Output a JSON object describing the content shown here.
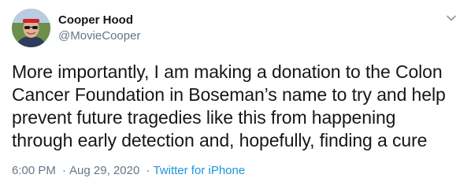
{
  "author": {
    "display_name": "Cooper Hood",
    "handle": "@MovieCooper"
  },
  "tweet": {
    "text": "More importantly, I am making a donation to the Colon Cancer Foundation in Boseman’s name to try and help prevent future tragedies like this from happening through early detection and, hopefully, finding a cure",
    "time": "6:00 PM",
    "separator": "·",
    "date": "Aug 29, 2020",
    "source": "Twitter for iPhone"
  },
  "icons": {
    "menu": "chevron-down-icon",
    "avatar": "profile-photo"
  },
  "colors": {
    "text": "#14171a",
    "secondary": "#657786",
    "link": "#1b95e0"
  }
}
